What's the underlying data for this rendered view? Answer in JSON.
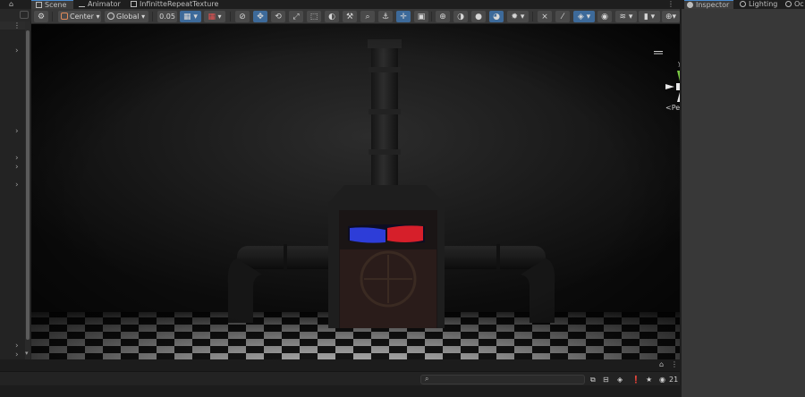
{
  "tabs": {
    "lock_icon": "lock-icon",
    "scene": "Scene",
    "animator": "Animator",
    "texture": "InfinitteRepeatTexture",
    "more": "⋮",
    "inspector": "Inspector",
    "lighting": "Lighting",
    "occlusion": "Oc"
  },
  "hierarchy": {
    "dots": "⋮",
    "chevron": "›",
    "down_arrow": "▾"
  },
  "toolbar": {
    "pivot_label": "Center",
    "space_label": "Global",
    "snap_value": "0.05"
  },
  "viewport": {
    "gizmo_axes": {
      "y": "y",
      "x": "x"
    },
    "persp_label": "<Persp",
    "lock": "🔒"
  },
  "console": {
    "lock": "🔒",
    "more": "⋮",
    "eye_count": "21"
  },
  "colors": {
    "accent": "#3d6a9a",
    "gizmo_red": "#d04848",
    "gizmo_green": "#7ac943"
  }
}
